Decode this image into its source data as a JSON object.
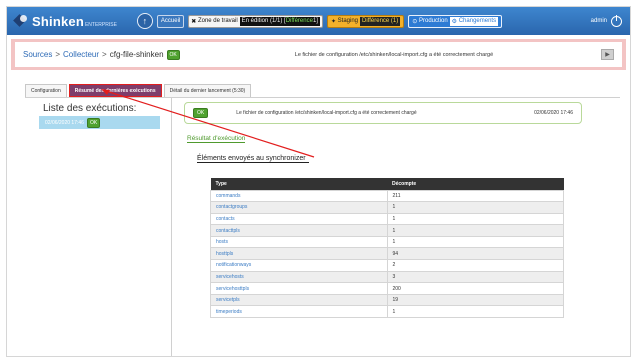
{
  "topbar": {
    "logo": "Shinken",
    "logo_sub": "ENTERPRISE",
    "accueil": "Accueil",
    "zone_label": "Zone de travail",
    "zone_edit_prefix": "En édition (1/1) [",
    "zone_edit_hl": "Différence",
    "zone_edit_suffix": " 1]",
    "staging_label": "Staging",
    "staging_diff": "Différence (1)",
    "production_label": "Production",
    "production_changes": "Changements",
    "admin": "admin"
  },
  "breadcrumb": {
    "sources": "Sources",
    "collecteur": "Collecteur",
    "current": "cfg-file-shinken",
    "sep": ">",
    "status": "OK",
    "message": "Le fichier de configuration /etc/shinken/local-import.cfg a été correctement chargé"
  },
  "tabs": [
    {
      "label": "Configuration"
    },
    {
      "label": "Résumé des dernières exécutions"
    },
    {
      "label": "Détail du dernier lancement (5:30)"
    }
  ],
  "left": {
    "title": "Liste des exécutions:",
    "exec_date": "02/06/2020 17:46",
    "exec_status": "OK"
  },
  "message_box": {
    "status": "OK",
    "text": "Le fichier de configuration /etc/shinken/local-import.cfg a été correctement chargé",
    "date": "02/06/2020 17:46"
  },
  "result_title": "Résultat d'exécution",
  "sent_title": "Éléments envoyés au synchronizer",
  "table": {
    "headers": [
      "Type",
      "Décompte"
    ],
    "rows": [
      {
        "type": "commands",
        "count": "211"
      },
      {
        "type": "contactgroups",
        "count": "1"
      },
      {
        "type": "contacts",
        "count": "1"
      },
      {
        "type": "contacttpls",
        "count": "1"
      },
      {
        "type": "hosts",
        "count": "1"
      },
      {
        "type": "hosttpls",
        "count": "94"
      },
      {
        "type": "notificationways",
        "count": "2"
      },
      {
        "type": "servicehosts",
        "count": "3"
      },
      {
        "type": "servicehosttpls",
        "count": "200"
      },
      {
        "type": "servicetpls",
        "count": "19"
      },
      {
        "type": "timeperiods",
        "count": "1"
      }
    ]
  },
  "colors": {
    "topbar": "#2a66ad",
    "active_tab": "#7e3d6b",
    "annotation": "#e21e1e",
    "ok": "#4fa22f"
  }
}
